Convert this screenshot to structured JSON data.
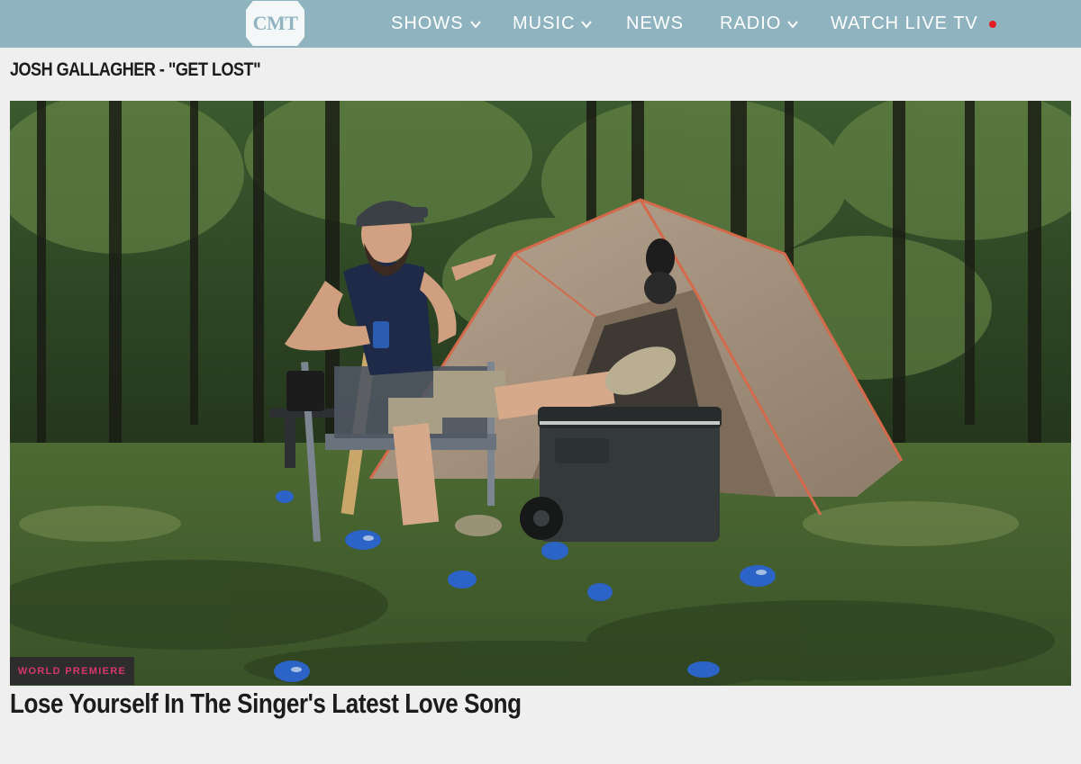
{
  "header": {
    "logo_text": "CMT",
    "nav": [
      {
        "label": "SHOWS",
        "has_dropdown": true
      },
      {
        "label": "MUSIC",
        "has_dropdown": true
      },
      {
        "label": "NEWS",
        "has_dropdown": false
      },
      {
        "label": "RADIO",
        "has_dropdown": true
      },
      {
        "label": "WATCH LIVE TV",
        "has_dropdown": false,
        "live_indicator": true
      }
    ],
    "colors": {
      "bar": "#8fb4bf",
      "live_dot": "#e51d25"
    }
  },
  "page": {
    "title": "JOSH GALLAGHER - \"GET LOST\""
  },
  "hero": {
    "badge": "WORLD PREMIERE",
    "headline": "Lose Yourself In The Singer's Latest Love Song"
  },
  "colors": {
    "badge_text": "#d6366b",
    "badge_bg": "#2d2d2d"
  }
}
